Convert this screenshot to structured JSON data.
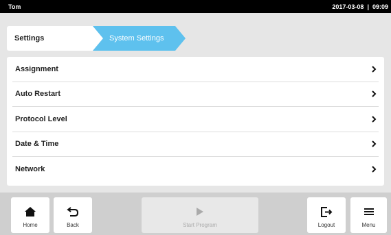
{
  "status": {
    "user": "Tom",
    "date": "2017-03-08",
    "separator": "|",
    "time": "09:09"
  },
  "breadcrumb": {
    "root": "Settings",
    "current": "System Settings"
  },
  "settings_list": [
    {
      "label": "Assignment",
      "icon": "chevron-right-icon"
    },
    {
      "label": "Auto Restart",
      "icon": "chevron-right-icon"
    },
    {
      "label": "Protocol Level",
      "icon": "chevron-right-icon"
    },
    {
      "label": "Date & Time",
      "icon": "chevron-right-icon"
    },
    {
      "label": "Network",
      "icon": "chevron-right-icon"
    }
  ],
  "bottom_nav": {
    "home": {
      "label": "Home",
      "icon": "home-icon"
    },
    "back": {
      "label": "Back",
      "icon": "back-arrow-icon"
    },
    "start": {
      "label": "Start Program",
      "icon": "play-icon",
      "enabled": false
    },
    "logout": {
      "label": "Logout",
      "icon": "logout-icon"
    },
    "menu": {
      "label": "Menu",
      "icon": "hamburger-menu-icon"
    }
  },
  "colors": {
    "accent": "#5ec1ee",
    "statusbar": "#000000",
    "background": "#e6e6e6",
    "bottombar": "#cfcfcf"
  }
}
